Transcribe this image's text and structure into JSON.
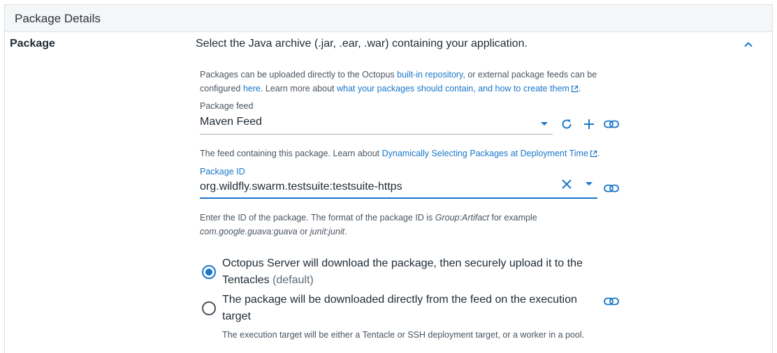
{
  "section": {
    "title": "Package Details"
  },
  "package": {
    "label": "Package",
    "summary": "Select the Java archive (.jar, .ear, .war) containing your application.",
    "help": {
      "part1": "Packages can be uploaded directly to the Octopus ",
      "builtin_link": "built-in repository",
      "part2": ", or external package feeds can be",
      "part3": "configured ",
      "here_link": "here",
      "part4": ". Learn more about ",
      "contain_link": "what your packages should contain, and how to create them",
      "part5": "."
    }
  },
  "feed": {
    "label": "Package feed",
    "value": "Maven Feed",
    "help_prefix": "The feed containing this package. Learn about ",
    "help_link": "Dynamically Selecting Packages at Deployment Time",
    "help_suffix": "."
  },
  "package_id": {
    "label": "Package ID",
    "value": "org.wildfly.swarm.testsuite:testsuite-https",
    "help_line1_prefix": "Enter the ID of the package. The format of the package ID is ",
    "help_line1_em": "Group:Artifact",
    "help_line1_suffix": " for example",
    "help_line2_em1": "com.google.guava:guava",
    "help_line2_mid": " or ",
    "help_line2_em2": "junit:junit",
    "help_line2_suffix": "."
  },
  "acquisition": {
    "option1_line1": "Octopus Server will download the package, then securely upload it to the",
    "option1_line2": "Tentacles",
    "option1_default": "(default)",
    "option2_line1": "The package will be downloaded directly from the feed on the execution",
    "option2_line2": "target",
    "option2_help": "The execution target will be either a Tentacle or SSH deployment target, or a worker in a pool.",
    "selected": 1
  },
  "colors": {
    "accent": "#1a77ca",
    "text": "#1f2a33",
    "muted": "#4a5561",
    "header_bg": "#f4f6f8"
  },
  "icons": [
    "chevron-up-icon",
    "external-link-icon",
    "dropdown-arrow-icon",
    "refresh-icon",
    "add-icon",
    "link-icon",
    "clear-icon"
  ]
}
